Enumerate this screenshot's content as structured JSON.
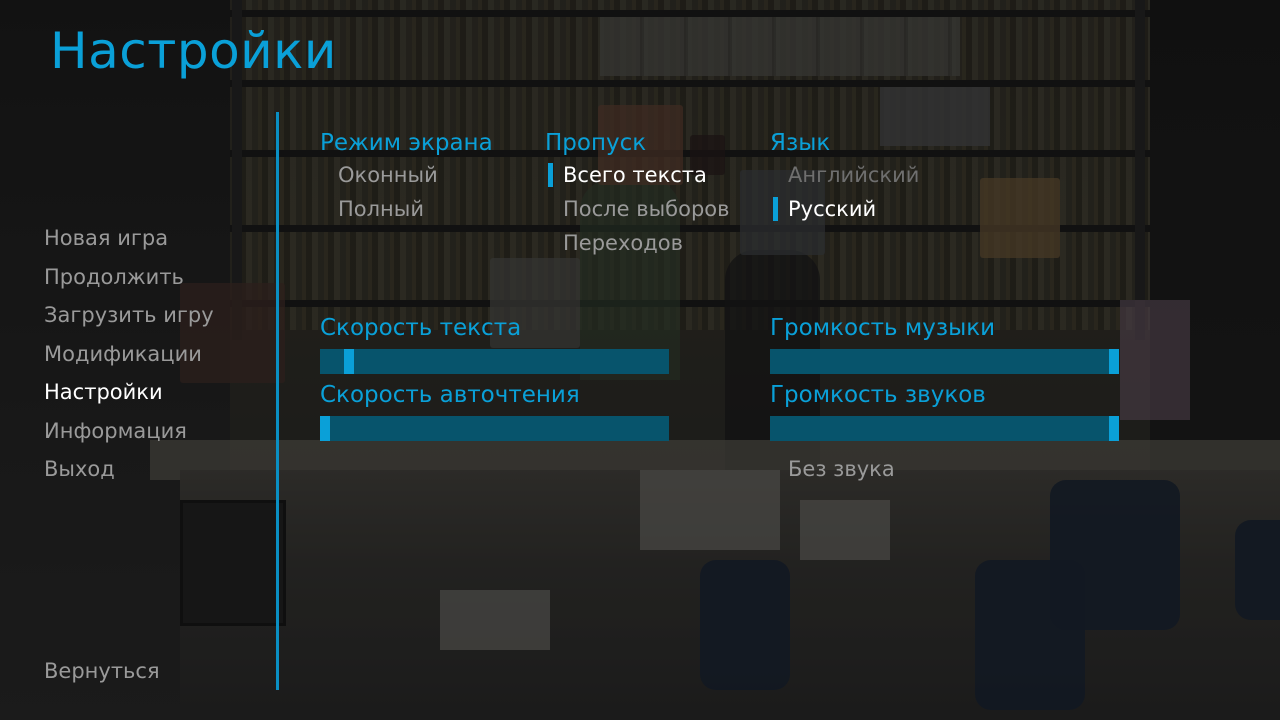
{
  "title": "Настройки",
  "nav": {
    "items": [
      {
        "label": "Новая игра"
      },
      {
        "label": "Продолжить"
      },
      {
        "label": "Загрузить игру"
      },
      {
        "label": "Модификации"
      },
      {
        "label": "Настройки",
        "selected": true
      },
      {
        "label": "Информация"
      },
      {
        "label": "Выход"
      }
    ],
    "back_label": "Вернуться"
  },
  "display": {
    "label": "Режим экрана",
    "options": [
      {
        "label": "Оконный",
        "selected": false
      },
      {
        "label": "Полный",
        "selected": false
      }
    ]
  },
  "skip": {
    "label": "Пропуск",
    "options": [
      {
        "label": "Всего текста",
        "selected": true
      },
      {
        "label": "После выборов",
        "selected": false
      },
      {
        "label": "Переходов",
        "selected": false
      }
    ]
  },
  "language": {
    "label": "Язык",
    "options": [
      {
        "label": "Английский",
        "selected": false,
        "disabled": true
      },
      {
        "label": "Русский",
        "selected": true
      }
    ]
  },
  "sliders": {
    "text_speed": {
      "label": "Скорость текста",
      "value": 0.07
    },
    "auto_forward": {
      "label": "Скорость авточтения",
      "value": 0.0
    },
    "music_volume": {
      "label": "Громкость музыки",
      "value": 1.0
    },
    "sound_volume": {
      "label": "Громкость звуков",
      "value": 1.0
    }
  },
  "mute_label": "Без звука",
  "colors": {
    "accent": "#0aa0d8",
    "track": "#07546c",
    "text_idle": "#9a9a9a",
    "text_selected": "#ffffff"
  }
}
